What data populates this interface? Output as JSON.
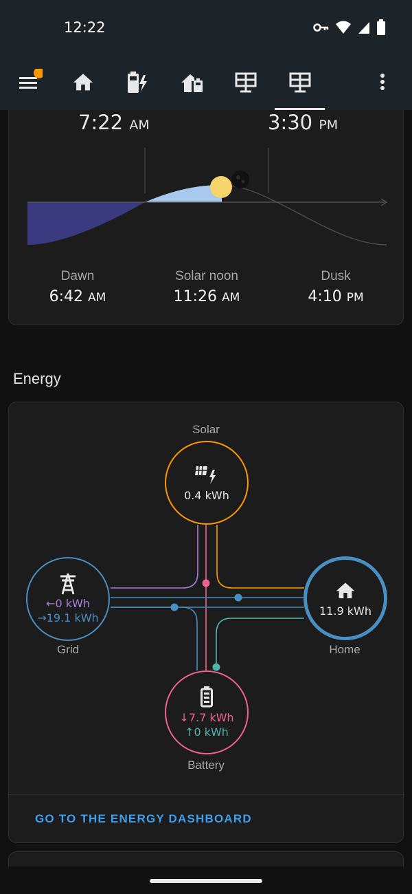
{
  "status_bar": {
    "time": "12:22",
    "icons": [
      "vpn-key-icon",
      "wifi-icon",
      "cell-signal-icon",
      "battery-icon"
    ]
  },
  "toolbar": {
    "tabs": [
      {
        "name": "menu-icon",
        "badge": true
      },
      {
        "name": "home-icon"
      },
      {
        "name": "battery-charging-icon"
      },
      {
        "name": "home-battery-icon"
      },
      {
        "name": "solar-panel-icon"
      },
      {
        "name": "solar-panel-icon",
        "active": true
      },
      {
        "name": "more-vertical-icon"
      }
    ]
  },
  "sun": {
    "sunrise": {
      "time": "7:22",
      "ampm": "AM"
    },
    "sunset": {
      "time": "3:30",
      "ampm": "PM"
    },
    "dawn": {
      "label": "Dawn",
      "time": "6:42",
      "ampm": "AM"
    },
    "noon": {
      "label": "Solar noon",
      "time": "11:26",
      "ampm": "AM"
    },
    "dusk": {
      "label": "Dusk",
      "time": "4:10",
      "ampm": "PM"
    }
  },
  "energy": {
    "title": "Energy",
    "solar": {
      "label": "Solar",
      "value": "0.4 kWh"
    },
    "grid": {
      "label": "Grid",
      "from": "←0 kWh",
      "to": "→19.1 kWh"
    },
    "home": {
      "label": "Home",
      "value": "11.9 kWh"
    },
    "battery": {
      "label": "Battery",
      "in": "↓7.7 kWh",
      "out": "↑0 kWh"
    },
    "link": "GO TO THE ENERGY DASHBOARD"
  },
  "colors": {
    "solar": "#ff9800",
    "grid": "#488fc2",
    "home": "#488fc2",
    "battery": "#f06292",
    "grid_return": "#a280db",
    "battery_out": "#4db6ac",
    "link": "#3ca0ec"
  }
}
